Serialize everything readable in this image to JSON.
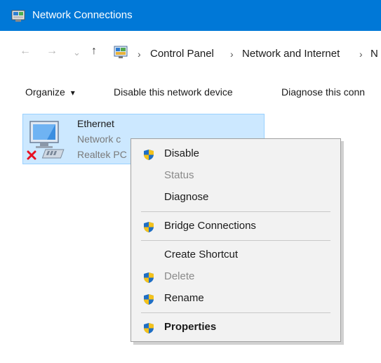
{
  "window": {
    "title": "Network Connections",
    "icon": "network-connections-icon"
  },
  "address": {
    "back_icon": "←",
    "forward_icon": "→",
    "recent_icon": "⌄",
    "up_icon": "↑",
    "crumbs": [
      "Control Panel",
      "Network and Internet",
      "N"
    ],
    "separator": "›"
  },
  "commands": {
    "organize": "Organize",
    "organize_arrow": "▾",
    "disable": "Disable this network device",
    "diagnose": "Diagnose this conn"
  },
  "connection": {
    "name": "Ethernet",
    "status": "Network c",
    "adapter": "Realtek PC",
    "status_color": "#e81123"
  },
  "context_menu": {
    "items": [
      {
        "label": "Disable",
        "shield": true,
        "enabled": true
      },
      {
        "label": "Status",
        "shield": false,
        "enabled": false
      },
      {
        "label": "Diagnose",
        "shield": false,
        "enabled": true
      },
      {
        "label": "Bridge Connections",
        "shield": true,
        "enabled": true
      },
      {
        "label": "Create Shortcut",
        "shield": false,
        "enabled": true
      },
      {
        "label": "Delete",
        "shield": true,
        "enabled": false
      },
      {
        "label": "Rename",
        "shield": true,
        "enabled": true
      },
      {
        "label": "Properties",
        "shield": true,
        "enabled": true,
        "default": true
      }
    ]
  },
  "colors": {
    "accent": "#0078d7",
    "selection": "#cce8ff",
    "shield_blue": "#1f6fc5",
    "shield_yellow": "#f4c21b"
  }
}
